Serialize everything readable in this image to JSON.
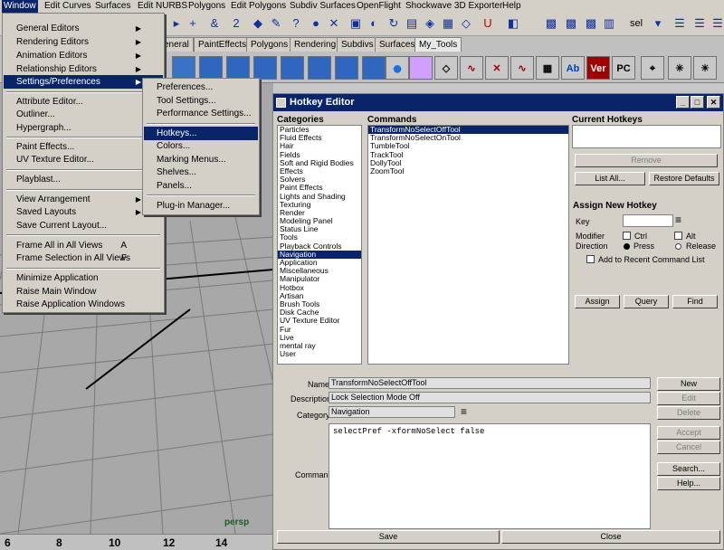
{
  "menubar": [
    "Window",
    "Edit Curves",
    "Surfaces",
    "Edit NURBS",
    "Polygons",
    "Edit Polygons",
    "Subdiv Surfaces",
    "OpenFlight",
    "Shockwave 3D Exporter",
    "Help"
  ],
  "toolbar_field": "sel",
  "shelf_tabs": [
    "eneral",
    "PaintEffects",
    "Polygons",
    "Rendering",
    "Subdivs",
    "Surfaces",
    "My_Tools"
  ],
  "shelf_labels": {
    "ver": "Ver",
    "pc": "PC"
  },
  "window_menu": {
    "group1": [
      "General Editors",
      "Rendering Editors",
      "Animation Editors",
      "Relationship Editors",
      "Settings/Preferences"
    ],
    "group2": [
      "Attribute Editor...",
      "Outliner...",
      "Hypergraph..."
    ],
    "group3": [
      "Paint Effects...",
      "UV Texture Editor..."
    ],
    "group4": [
      "Playblast..."
    ],
    "group5": [
      "View Arrangement",
      "Saved Layouts",
      "Save Current Layout..."
    ],
    "group6": [
      {
        "label": "Frame All in All Views",
        "acc": "A"
      },
      {
        "label": "Frame Selection in All Views",
        "acc": "F"
      }
    ],
    "group7": [
      "Minimize Application",
      "Raise Main Window",
      "Raise Application Windows"
    ]
  },
  "settings_menu": [
    "Preferences...",
    "Tool Settings...",
    "Performance Settings...",
    "Hotkeys...",
    "Colors...",
    "Marking Menus...",
    "Shelves...",
    "Panels...",
    "Plug-in Manager..."
  ],
  "viewport": {
    "label": "persp"
  },
  "ruler": [
    "6",
    "8",
    "10",
    "12",
    "14"
  ],
  "hotkey_editor": {
    "title": "Hotkey Editor",
    "categories_label": "Categories",
    "commands_label": "Commands",
    "categories": [
      "Particles",
      "Fluid Effects",
      "Hair",
      "Fields",
      "Soft and Rigid Bodies",
      "Effects",
      "Solvers",
      "Paint Effects",
      "Lights and Shading",
      "Texturing",
      "Render",
      "Modeling Panel",
      "Status Line",
      "Tools",
      "Playback Controls",
      "Navigation",
      "Application",
      "Miscellaneous",
      "Manipulator",
      "Hotbox",
      "Artisan",
      "Brush Tools",
      "Disk Cache",
      "UV Texture Editor",
      "Fur",
      "Live",
      "mental ray",
      "User"
    ],
    "selected_category": "Navigation",
    "commands": [
      "TransformNoSelectOffTool",
      "TransformNoSelectOnTool",
      "TumbleTool",
      "TrackTool",
      "DollyTool",
      "ZoomTool"
    ],
    "current_hotkeys_label": "Current Hotkeys",
    "remove": "Remove",
    "list_all": "List All...",
    "restore_defaults": "Restore Defaults",
    "assign_new_label": "Assign New Hotkey",
    "key_label": "Key",
    "modifier_label": "Modifier",
    "ctrl": "Ctrl",
    "alt": "Alt",
    "direction_label": "Direction",
    "press": "Press",
    "release": "Release",
    "add_recent": "Add to Recent Command List",
    "assign": "Assign",
    "query": "Query",
    "find": "Find",
    "name_label": "Name",
    "name_value": "TransformNoSelectOffTool",
    "description_label": "Description",
    "description_value": "Lock Selection Mode Off",
    "category_label": "Category",
    "category_value": "Navigation",
    "command_label": "Command",
    "command_value": "selectPref -xformNoSelect false",
    "new": "New",
    "edit": "Edit",
    "delete": "Delete",
    "accept": "Accept",
    "cancel": "Cancel",
    "search": "Search...",
    "help": "Help...",
    "save": "Save",
    "close": "Close"
  }
}
